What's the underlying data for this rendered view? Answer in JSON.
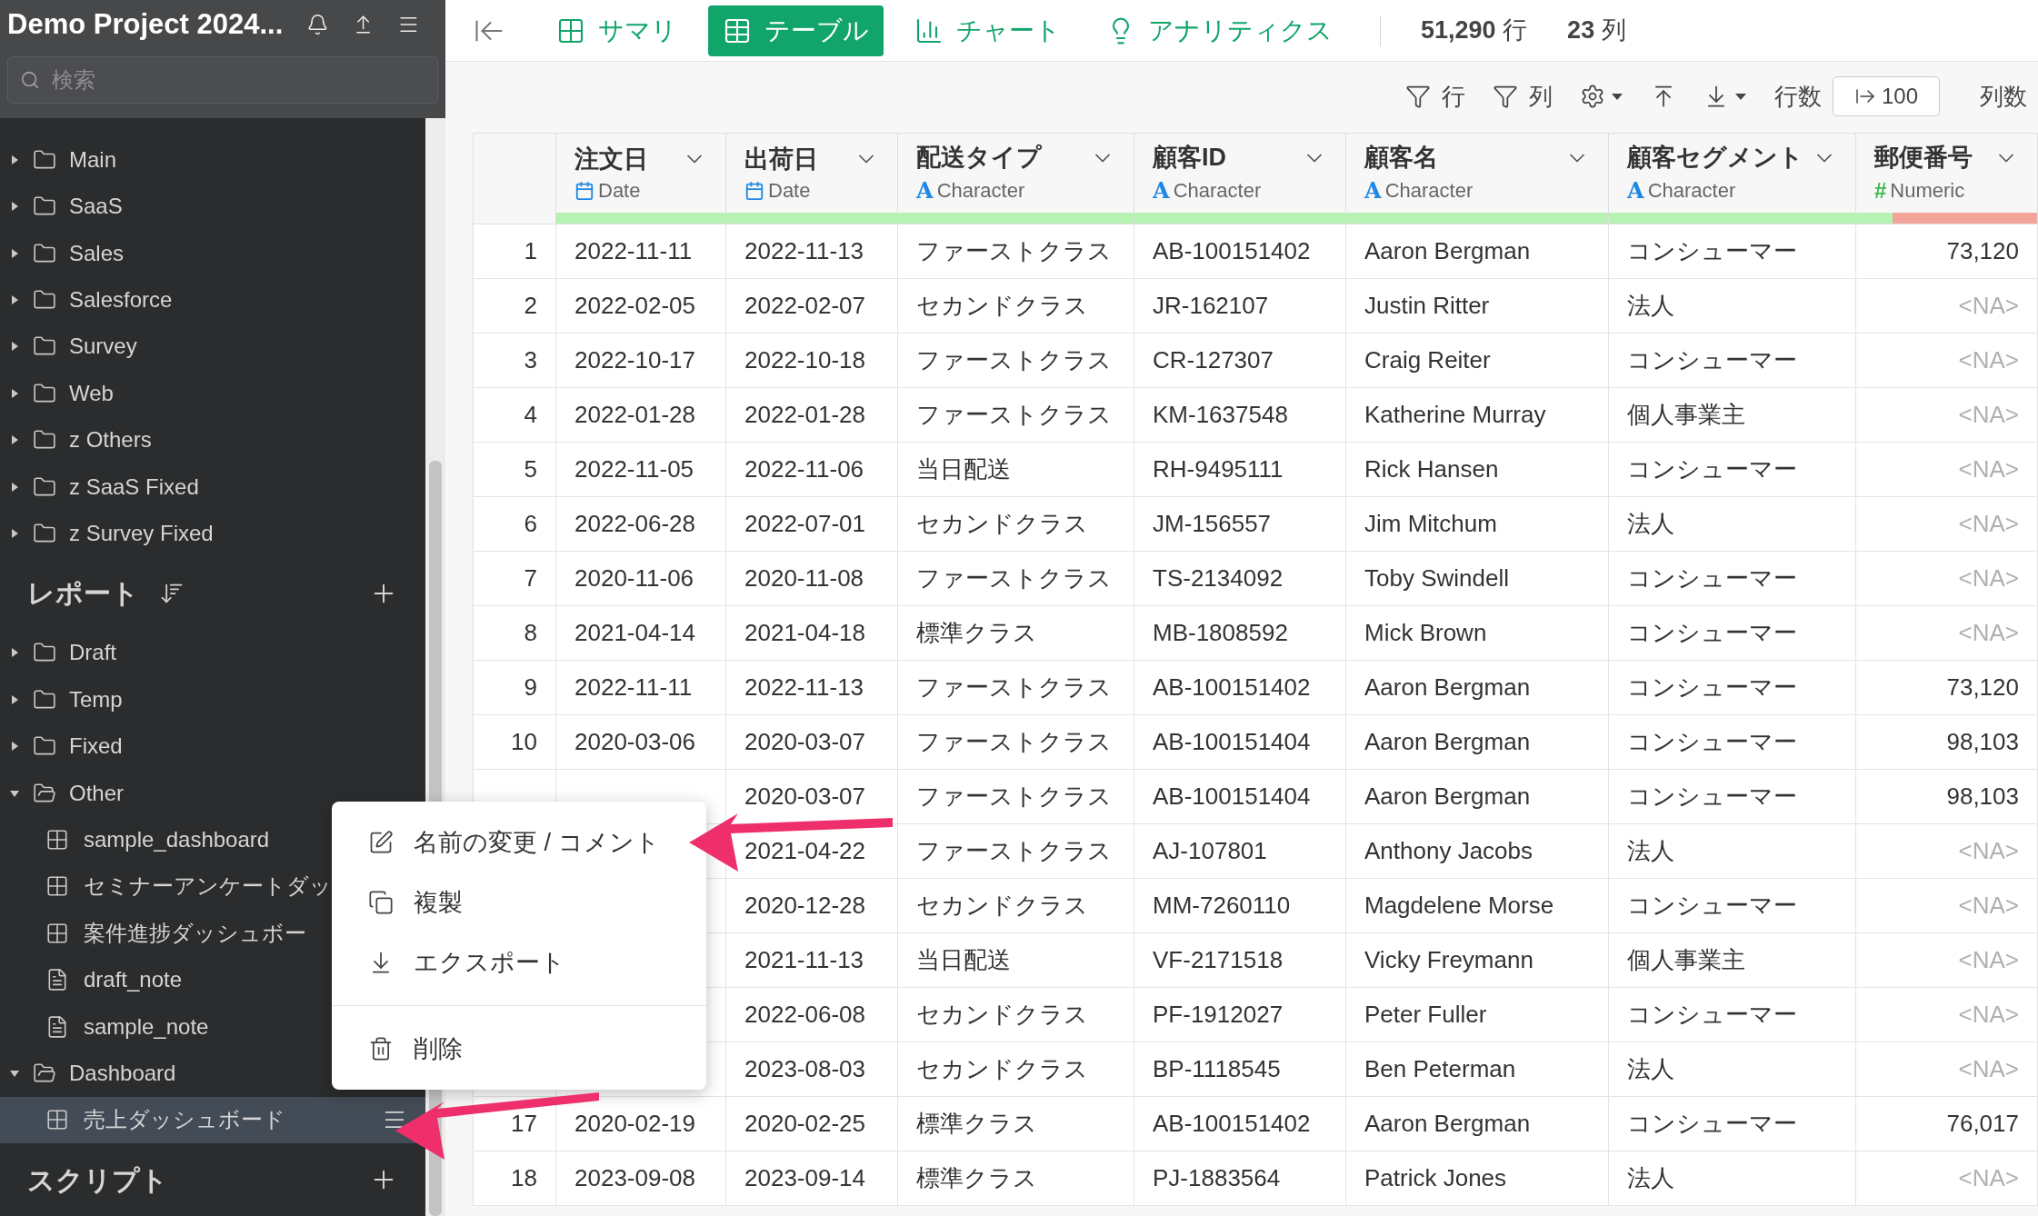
{
  "sidebar": {
    "project_title": "Demo Project 2024...",
    "search": {
      "placeholder": "検索"
    },
    "data_folders": [
      {
        "label": "Main",
        "expanded": false
      },
      {
        "label": "SaaS",
        "expanded": false
      },
      {
        "label": "Sales",
        "expanded": false
      },
      {
        "label": "Salesforce",
        "expanded": false
      },
      {
        "label": "Survey",
        "expanded": false
      },
      {
        "label": "Web",
        "expanded": false
      },
      {
        "label": "z Others",
        "expanded": false
      },
      {
        "label": "z SaaS Fixed",
        "expanded": false
      },
      {
        "label": "z Survey Fixed",
        "expanded": false
      }
    ],
    "reports": {
      "title": "レポート",
      "folders": [
        {
          "label": "Draft",
          "expanded": false
        },
        {
          "label": "Temp",
          "expanded": false
        },
        {
          "label": "Fixed",
          "expanded": false
        },
        {
          "label": "Other",
          "expanded": true,
          "children": [
            {
              "kind": "dashboard",
              "label": "sample_dashboard",
              "selected": false
            },
            {
              "kind": "dashboard",
              "label": "セミナーアンケートダッ",
              "selected": false
            },
            {
              "kind": "dashboard",
              "label": "案件進捗ダッシュボー",
              "selected": false
            },
            {
              "kind": "note",
              "label": "draft_note",
              "selected": false
            },
            {
              "kind": "note",
              "label": "sample_note",
              "selected": false
            }
          ]
        },
        {
          "label": "Dashboard",
          "expanded": true,
          "children": [
            {
              "kind": "dashboard",
              "label": "売上ダッシュボード",
              "selected": true
            }
          ]
        }
      ]
    },
    "scripts": {
      "title": "スクリプト"
    }
  },
  "toolbar": {
    "tabs": [
      {
        "kind": "summary",
        "label": "サマリ",
        "selected": false
      },
      {
        "kind": "table",
        "label": "テーブル",
        "selected": true
      },
      {
        "kind": "chart",
        "label": "チャート",
        "selected": false
      },
      {
        "kind": "analytics",
        "label": "アナリティクス",
        "selected": false
      }
    ],
    "row_count": {
      "value": "51,290",
      "unit": "行"
    },
    "column_count": {
      "value": "23",
      "unit": "列"
    }
  },
  "actions": {
    "filter_rows": "行",
    "filter_columns": "列",
    "rows_label": "行数",
    "rows_value": "100",
    "columns_label": "列数"
  },
  "table": {
    "columns": [
      {
        "name": "注文日",
        "type": "Date",
        "kind": "date",
        "level": 1
      },
      {
        "name": "出荷日",
        "type": "Date",
        "kind": "date",
        "level": 1
      },
      {
        "name": "配送タイプ",
        "type": "Character",
        "kind": "character",
        "type_symbol": "A",
        "level": 1
      },
      {
        "name": "顧客ID",
        "type": "Character",
        "kind": "character",
        "type_symbol": "A",
        "level": 1
      },
      {
        "name": "顧客名",
        "type": "Character",
        "kind": "character",
        "type_symbol": "A",
        "level": 1
      },
      {
        "name": "顧客セグメント",
        "type": "Character",
        "kind": "character",
        "type_symbol": "A",
        "level": 1
      },
      {
        "name": "郵便番号",
        "type": "Numeric",
        "kind": "numeric",
        "type_symbol": "#",
        "level": 0.2
      }
    ],
    "rows": [
      {
        "number": "1",
        "cells": [
          "2022-11-11",
          "2022-11-13",
          "ファーストクラス",
          "AB-100151402",
          "Aaron Bergman",
          "コンシューマー",
          "73,120"
        ],
        "zip_na": false
      },
      {
        "number": "2",
        "cells": [
          "2022-02-05",
          "2022-02-07",
          "セカンドクラス",
          "JR-162107",
          "Justin Ritter",
          "法人",
          "<NA>"
        ],
        "zip_na": true
      },
      {
        "number": "3",
        "cells": [
          "2022-10-17",
          "2022-10-18",
          "ファーストクラス",
          "CR-127307",
          "Craig Reiter",
          "コンシューマー",
          "<NA>"
        ],
        "zip_na": true
      },
      {
        "number": "4",
        "cells": [
          "2022-01-28",
          "2022-01-28",
          "ファーストクラス",
          "KM-1637548",
          "Katherine Murray",
          "個人事業主",
          "<NA>"
        ],
        "zip_na": true
      },
      {
        "number": "5",
        "cells": [
          "2022-11-05",
          "2022-11-06",
          "当日配送",
          "RH-9495111",
          "Rick Hansen",
          "コンシューマー",
          "<NA>"
        ],
        "zip_na": true
      },
      {
        "number": "6",
        "cells": [
          "2022-06-28",
          "2022-07-01",
          "セカンドクラス",
          "JM-156557",
          "Jim Mitchum",
          "法人",
          "<NA>"
        ],
        "zip_na": true
      },
      {
        "number": "7",
        "cells": [
          "2020-11-06",
          "2020-11-08",
          "ファーストクラス",
          "TS-2134092",
          "Toby Swindell",
          "コンシューマー",
          "<NA>"
        ],
        "zip_na": true
      },
      {
        "number": "8",
        "cells": [
          "2021-04-14",
          "2021-04-18",
          "標準クラス",
          "MB-1808592",
          "Mick Brown",
          "コンシューマー",
          "<NA>"
        ],
        "zip_na": true
      },
      {
        "number": "9",
        "cells": [
          "2022-11-11",
          "2022-11-13",
          "ファーストクラス",
          "AB-100151402",
          "Aaron Bergman",
          "コンシューマー",
          "73,120"
        ],
        "zip_na": false
      },
      {
        "number": "10",
        "cells": [
          "2020-03-06",
          "2020-03-07",
          "ファーストクラス",
          "AB-100151404",
          "Aaron Bergman",
          "コンシューマー",
          "98,103"
        ],
        "zip_na": false
      },
      {
        "number": null,
        "cells": [
          null,
          "2020-03-07",
          "ファーストクラス",
          "AB-100151404",
          "Aaron Bergman",
          "コンシューマー",
          "98,103"
        ],
        "zip_na": false
      },
      {
        "number": null,
        "cells": [
          null,
          "2021-04-22",
          "ファーストクラス",
          "AJ-107801",
          "Anthony Jacobs",
          "法人",
          "<NA>"
        ],
        "zip_na": true
      },
      {
        "number": null,
        "cells": [
          null,
          "2020-12-28",
          "セカンドクラス",
          "MM-7260110",
          "Magdelene Morse",
          "コンシューマー",
          "<NA>"
        ],
        "zip_na": true
      },
      {
        "number": null,
        "cells": [
          null,
          "2021-11-13",
          "当日配送",
          "VF-2171518",
          "Vicky Freymann",
          "個人事業主",
          "<NA>"
        ],
        "zip_na": true
      },
      {
        "number": null,
        "cells": [
          null,
          "2022-06-08",
          "セカンドクラス",
          "PF-1912027",
          "Peter Fuller",
          "コンシューマー",
          "<NA>"
        ],
        "zip_na": true
      },
      {
        "number": null,
        "cells": [
          null,
          "2023-08-03",
          "セカンドクラス",
          "BP-1118545",
          "Ben Peterman",
          "法人",
          "<NA>"
        ],
        "zip_na": true
      },
      {
        "number": "17",
        "cells": [
          "2020-02-19",
          "2020-02-25",
          "標準クラス",
          "AB-100151402",
          "Aaron Bergman",
          "コンシューマー",
          "76,017"
        ],
        "zip_na": false
      },
      {
        "number": "18",
        "cells": [
          "2023-09-08",
          "2023-09-14",
          "標準クラス",
          "PJ-1883564",
          "Patrick Jones",
          "法人",
          "<NA>"
        ],
        "zip_na": true
      }
    ]
  },
  "context_menu": {
    "items": [
      {
        "kind": "rename",
        "label": "名前の変更 / コメント"
      },
      {
        "kind": "duplicate",
        "label": "複製"
      },
      {
        "kind": "export",
        "label": "エクスポート"
      },
      {
        "kind": "delete",
        "label": "削除"
      }
    ]
  }
}
